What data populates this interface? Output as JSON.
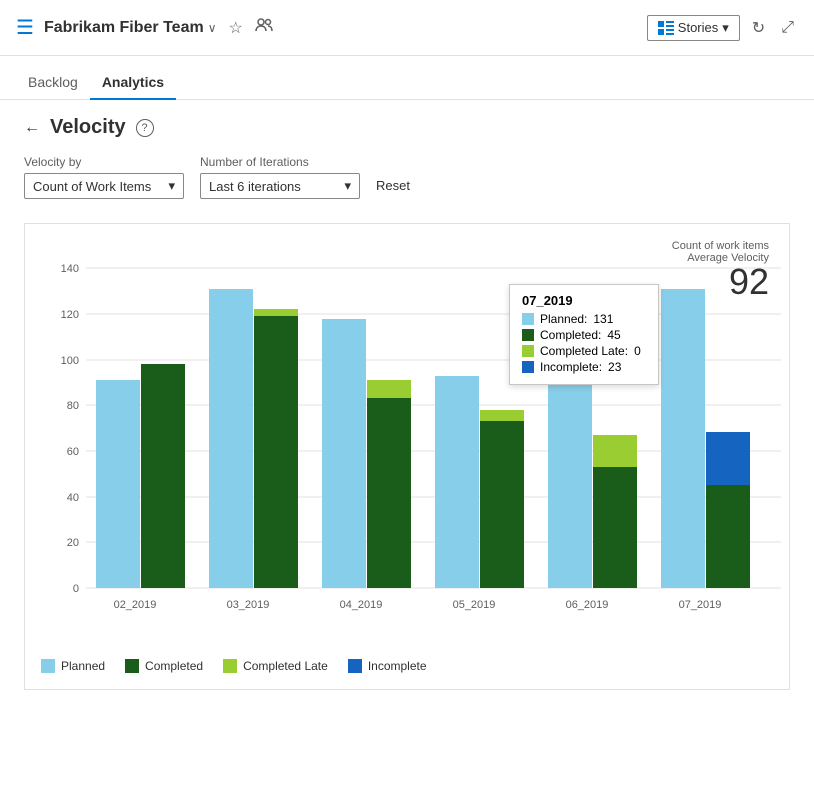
{
  "header": {
    "icon": "☰",
    "team_name": "Fabrikam Fiber Team",
    "chevron": "∨",
    "star_icon": "☆",
    "people_icon": "👥",
    "stories_label": "Stories",
    "stories_chevron": "∨",
    "refresh_icon": "↻",
    "expand_icon": "⤢"
  },
  "nav": {
    "tabs": [
      {
        "id": "backlog",
        "label": "Backlog",
        "active": false
      },
      {
        "id": "analytics",
        "label": "Analytics",
        "active": true
      }
    ]
  },
  "page": {
    "back_icon": "←",
    "title": "Velocity",
    "help_icon": "?",
    "velocity_by_label": "Velocity by",
    "velocity_by_value": "Count of Work Items",
    "iterations_label": "Number of Iterations",
    "iterations_value": "Last 6 iterations",
    "reset_label": "Reset"
  },
  "chart": {
    "meta_label1": "Count of work items",
    "meta_label2": "Average Velocity",
    "avg_velocity": "92",
    "y_axis": [
      0,
      20,
      40,
      60,
      80,
      100,
      120,
      140
    ],
    "bars": [
      {
        "sprint": "02_2019",
        "planned": 91,
        "completed": 98,
        "completed_late": 0,
        "incomplete": 0
      },
      {
        "sprint": "03_2019",
        "planned": 131,
        "completed": 119,
        "completed_late": 0,
        "incomplete": 0
      },
      {
        "sprint": "04_2019",
        "planned": 118,
        "completed": 83,
        "completed_late": 8,
        "incomplete": 0
      },
      {
        "sprint": "05_2019",
        "planned": 93,
        "completed": 73,
        "completed_late": 5,
        "incomplete": 0
      },
      {
        "sprint": "06_2019",
        "planned": 90,
        "completed": 53,
        "completed_late": 14,
        "incomplete": 0
      },
      {
        "sprint": "07_2019",
        "planned": 131,
        "completed": 45,
        "completed_late": 0,
        "incomplete": 23
      }
    ],
    "tooltip": {
      "sprint": "07_2019",
      "planned_label": "Planned:",
      "planned_val": "131",
      "completed_label": "Completed:",
      "completed_val": "45",
      "completed_late_label": "Completed Late:",
      "completed_late_val": "0",
      "incomplete_label": "Incomplete:",
      "incomplete_val": "23"
    },
    "legend": [
      {
        "id": "planned",
        "label": "Planned",
        "color": "#add8e6"
      },
      {
        "id": "completed",
        "label": "Completed",
        "color": "#1a5c1a"
      },
      {
        "id": "completed_late",
        "label": "Completed Late",
        "color": "#8db600"
      },
      {
        "id": "incomplete",
        "label": "Incomplete",
        "color": "#1e88e5"
      }
    ],
    "colors": {
      "planned": "#87ceeb",
      "completed": "#1a5c1a",
      "completed_late": "#9acd32",
      "incomplete": "#1565c0"
    }
  }
}
